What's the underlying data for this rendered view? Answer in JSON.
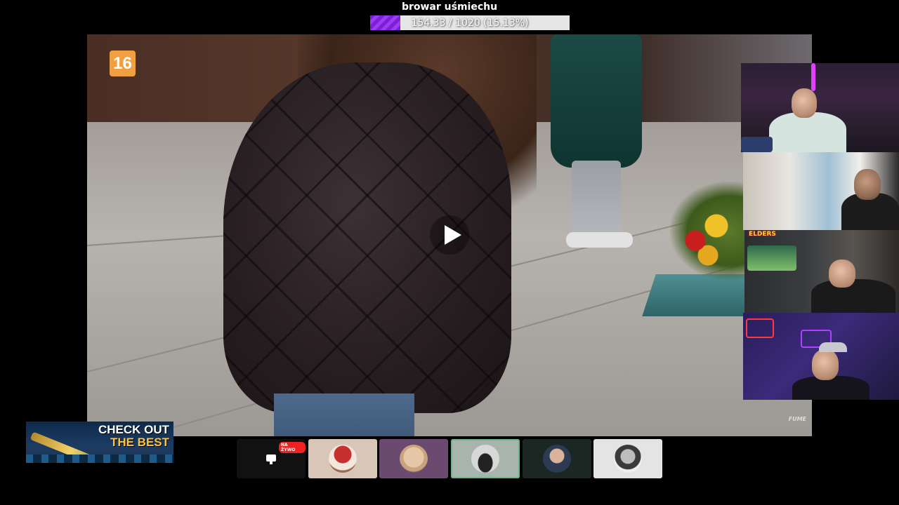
{
  "goal": {
    "title": "browar uśmiechu",
    "progress_text": "154.33 / 1020 (15.13%)",
    "progress_fraction": 0.1513,
    "fill_color": "#8a2be2"
  },
  "video": {
    "age_rating": "16",
    "watermark": "FUME",
    "play_icon": "play-icon"
  },
  "webcams": {
    "cam3_label": "ELDERS"
  },
  "banner": {
    "line1": "CHECK OUT",
    "line2": "THE BEST"
  },
  "thumbnails": [
    {
      "type": "live",
      "badge": "NA ŻYWO",
      "icon": "screen-share-icon"
    },
    {
      "type": "avatar",
      "icon": "santa-avatar"
    },
    {
      "type": "avatar",
      "icon": "glasses-face-avatar"
    },
    {
      "type": "avatar",
      "icon": "car-avatar",
      "active": true
    },
    {
      "type": "avatar",
      "icon": "man-avatar"
    },
    {
      "type": "avatar",
      "icon": "man-bw-avatar"
    }
  ]
}
